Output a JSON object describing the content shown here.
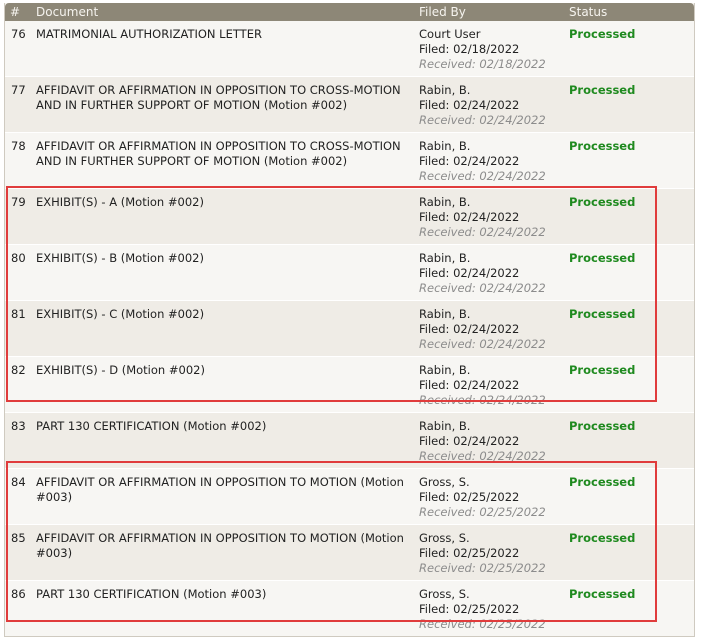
{
  "columns": {
    "num": "#",
    "document": "Document",
    "filed_by": "Filed By",
    "status": "Status"
  },
  "rows": [
    {
      "num": "76",
      "doc": "MATRIMONIAL AUTHORIZATION LETTER",
      "filer": "Court User",
      "filed": "Filed: 02/18/2022",
      "received": "Received: 02/18/2022",
      "status": "Processed"
    },
    {
      "num": "77",
      "doc": "AFFIDAVIT OR AFFIRMATION IN OPPOSITION TO CROSS-MOTION AND IN FURTHER SUPPORT OF MOTION  (Motion #002)",
      "filer": "Rabin, B.",
      "filed": "Filed: 02/24/2022",
      "received": "Received: 02/24/2022",
      "status": "Processed"
    },
    {
      "num": "78",
      "doc": "AFFIDAVIT OR AFFIRMATION IN OPPOSITION TO CROSS-MOTION AND IN FURTHER SUPPORT OF MOTION  (Motion #002)",
      "filer": "Rabin, B.",
      "filed": "Filed: 02/24/2022",
      "received": "Received: 02/24/2022",
      "status": "Processed"
    },
    {
      "num": "79",
      "doc": "EXHIBIT(S)  - A  (Motion #002)",
      "filer": "Rabin, B.",
      "filed": "Filed: 02/24/2022",
      "received": "Received: 02/24/2022",
      "status": "Processed"
    },
    {
      "num": "80",
      "doc": "EXHIBIT(S)  - B  (Motion #002)",
      "filer": "Rabin, B.",
      "filed": "Filed: 02/24/2022",
      "received": "Received: 02/24/2022",
      "status": "Processed"
    },
    {
      "num": "81",
      "doc": "EXHIBIT(S)  - C  (Motion #002)",
      "filer": "Rabin, B.",
      "filed": "Filed: 02/24/2022",
      "received": "Received: 02/24/2022",
      "status": "Processed"
    },
    {
      "num": "82",
      "doc": "EXHIBIT(S)  - D  (Motion #002)",
      "filer": "Rabin, B.",
      "filed": "Filed: 02/24/2022",
      "received": "Received: 02/24/2022",
      "status": "Processed"
    },
    {
      "num": "83",
      "doc": "PART 130 CERTIFICATION  (Motion #002)",
      "filer": "Rabin, B.",
      "filed": "Filed: 02/24/2022",
      "received": "Received: 02/24/2022",
      "status": "Processed"
    },
    {
      "num": "84",
      "doc": "AFFIDAVIT OR AFFIRMATION IN OPPOSITION TO MOTION  (Motion #003)",
      "filer": "Gross, S.",
      "filed": "Filed: 02/25/2022",
      "received": "Received: 02/25/2022",
      "status": "Processed"
    },
    {
      "num": "85",
      "doc": "AFFIDAVIT OR AFFIRMATION IN OPPOSITION TO MOTION  (Motion #003)",
      "filer": "Gross, S.",
      "filed": "Filed: 02/25/2022",
      "received": "Received: 02/25/2022",
      "status": "Processed"
    },
    {
      "num": "86",
      "doc": "PART 130 CERTIFICATION  (Motion #003)",
      "filer": "Gross, S.",
      "filed": "Filed: 02/25/2022",
      "received": "Received: 02/25/2022",
      "status": "Processed"
    }
  ],
  "colors": {
    "header_bg": "#8d8777",
    "status_green": "#1f8a1f",
    "highlight_red": "#e03c3c"
  }
}
